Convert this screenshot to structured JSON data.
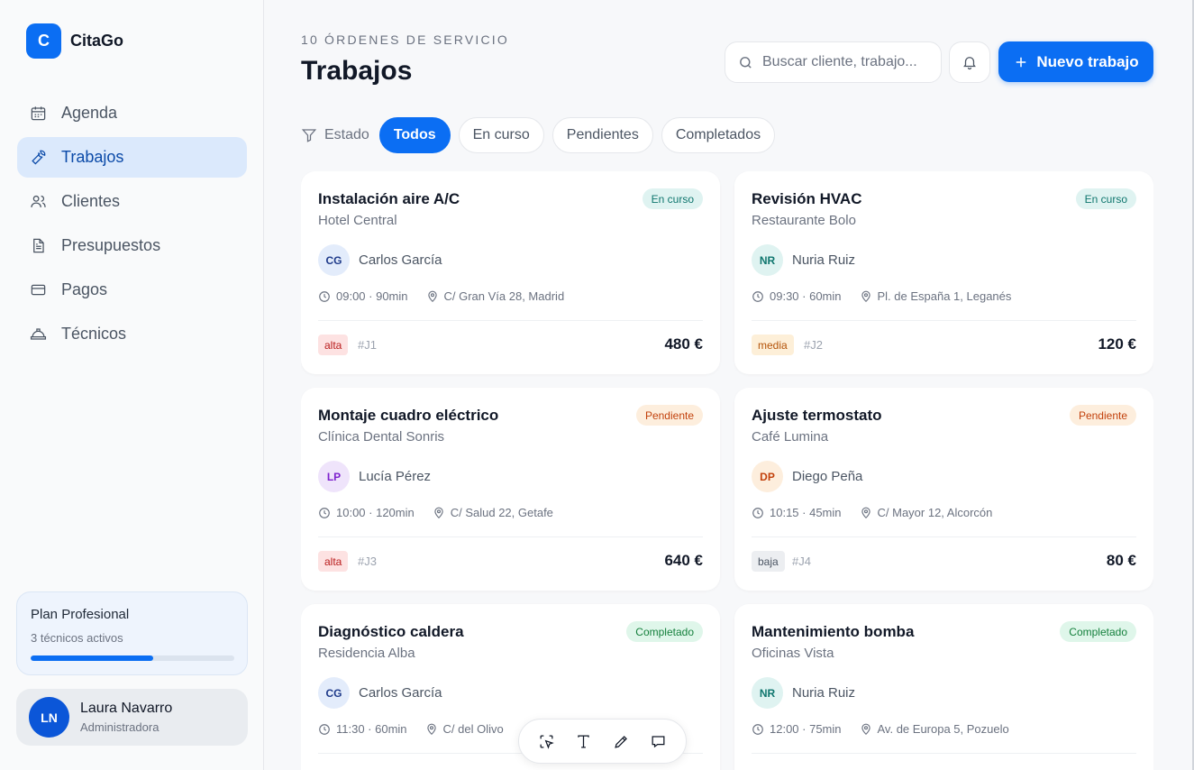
{
  "brand": {
    "logo_letter": "C",
    "name": "CitaGo"
  },
  "nav": [
    {
      "label": "Agenda",
      "icon": "calendar-icon"
    },
    {
      "label": "Trabajos",
      "icon": "wrench-icon",
      "active": true
    },
    {
      "label": "Clientes",
      "icon": "users-icon"
    },
    {
      "label": "Presupuestos",
      "icon": "document-icon"
    },
    {
      "label": "Pagos",
      "icon": "credit-card-icon"
    },
    {
      "label": "Técnicos",
      "icon": "hard-hat-icon"
    }
  ],
  "plan": {
    "title": "Plan Profesional",
    "subtitle": "3 técnicos activos",
    "progress_fraction": 0.6
  },
  "user": {
    "initials": "LN",
    "name": "Laura Navarro",
    "role": "Administradora"
  },
  "header": {
    "eyebrow": "10 ÓRDENES DE SERVICIO",
    "title": "Trabajos",
    "search_placeholder": "Buscar cliente, trabajo...",
    "new_button": "Nuevo trabajo"
  },
  "filters": {
    "label": "Estado",
    "chips": [
      "Todos",
      "En curso",
      "Pendientes",
      "Completados"
    ],
    "active": "Todos"
  },
  "jobs": [
    {
      "title": "Instalación aire A/C",
      "client": "Hotel Central",
      "status": "En curso",
      "status_kind": "curso",
      "tech_initials": "CG",
      "tech_name": "Carlos García",
      "time": "09:00 · 90min",
      "address": "C/ Gran Vía 28, Madrid",
      "priority": "alta",
      "id": "#J1",
      "price": "480 €"
    },
    {
      "title": "Revisión HVAC",
      "client": "Restaurante Bolo",
      "status": "En curso",
      "status_kind": "curso",
      "tech_initials": "NR",
      "tech_name": "Nuria Ruiz",
      "time": "09:30 · 60min",
      "address": "Pl. de España 1, Leganés",
      "priority": "media",
      "id": "#J2",
      "price": "120 €"
    },
    {
      "title": "Montaje cuadro eléctrico",
      "client": "Clínica Dental Sonris",
      "status": "Pendiente",
      "status_kind": "pend",
      "tech_initials": "LP",
      "tech_name": "Lucía Pérez",
      "time": "10:00 · 120min",
      "address": "C/ Salud 22, Getafe",
      "priority": "alta",
      "id": "#J3",
      "price": "640 €"
    },
    {
      "title": "Ajuste termostato",
      "client": "Café Lumina",
      "status": "Pendiente",
      "status_kind": "pend",
      "tech_initials": "DP",
      "tech_name": "Diego Peña",
      "time": "10:15 · 45min",
      "address": "C/ Mayor 12, Alcorcón",
      "priority": "baja",
      "id": "#J4",
      "price": "80 €"
    },
    {
      "title": "Diagnóstico caldera",
      "client": "Residencia Alba",
      "status": "Completado",
      "status_kind": "comp",
      "tech_initials": "CG",
      "tech_name": "Carlos García",
      "time": "11:30 · 60min",
      "address": "C/ del Olivo",
      "priority": "",
      "id": "",
      "price": ""
    },
    {
      "title": "Mantenimiento bomba",
      "client": "Oficinas Vista",
      "status": "Completado",
      "status_kind": "comp",
      "tech_initials": "NR",
      "tech_name": "Nuria Ruiz",
      "time": "12:00 · 75min",
      "address": "Av. de Europa 5, Pozuelo",
      "priority": "",
      "id": "",
      "price": ""
    }
  ],
  "tech_colors": {
    "CG": {
      "bg": "#e3ecfb",
      "fg": "#1e3a8a"
    },
    "NR": {
      "bg": "#dff3f1",
      "fg": "#0f766e"
    },
    "LP": {
      "bg": "#efe4fb",
      "fg": "#7e22ce"
    },
    "DP": {
      "bg": "#fdeedd",
      "fg": "#c2410c"
    }
  },
  "toolbar": [
    "select-icon",
    "text-icon",
    "pencil-icon",
    "comment-icon"
  ],
  "colors": {
    "accent": "#0b6ef3"
  }
}
